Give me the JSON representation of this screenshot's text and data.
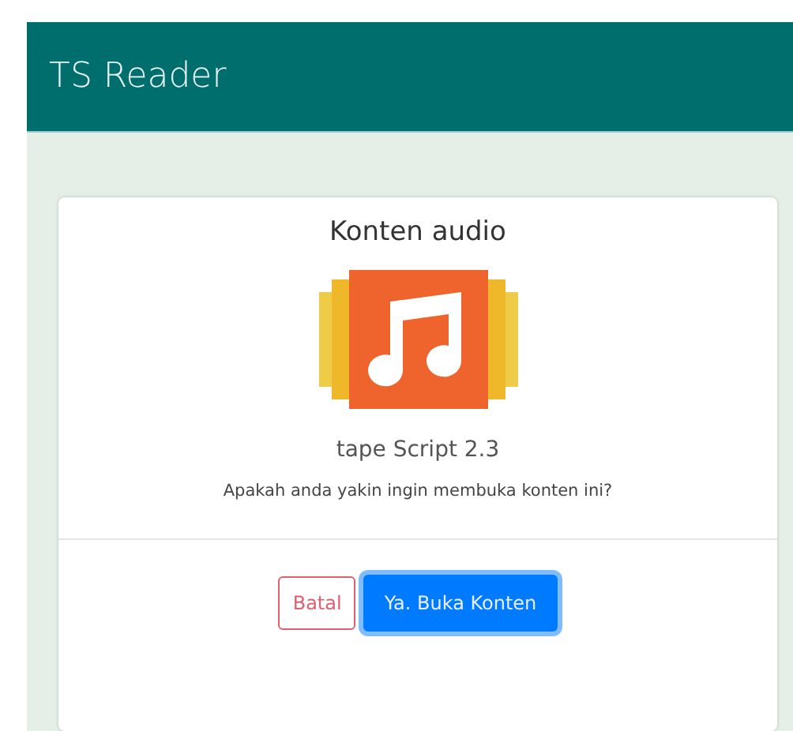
{
  "header": {
    "title": "TS Reader"
  },
  "dialog": {
    "title": "Konten audio",
    "name": "tape Script 2.3",
    "question": "Apakah anda yakin ingin membuka konten ini?",
    "buttons": [
      {
        "label": "Batal",
        "kind": "outline",
        "focused": false
      },
      {
        "label": "Ya. Buka Konten",
        "kind": "primary",
        "focused": true
      }
    ]
  }
}
